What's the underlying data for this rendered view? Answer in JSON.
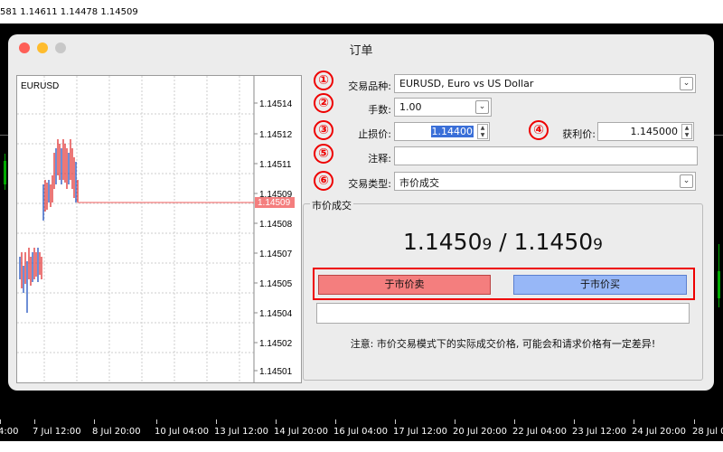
{
  "top_ticker": "581 1.14611 1.14478 1.14509",
  "window": {
    "title": "订单"
  },
  "chart": {
    "symbol": "EURUSD",
    "price_labels": [
      "1.14514",
      "1.14512",
      "1.14511",
      "1.14509",
      "1.14508",
      "1.14507",
      "1.14505",
      "1.14504",
      "1.14502",
      "1.14501"
    ],
    "current_price_tag": "1.14509",
    "colors": {
      "line": "#f47e7e",
      "tag_bg": "#f47e7e",
      "bull": "#e03030",
      "bear": "#2050c0"
    }
  },
  "form": {
    "circle_numbers": [
      "①",
      "②",
      "③",
      "④",
      "⑤",
      "⑥"
    ],
    "symbol_label": "交易品种:",
    "symbol_value": "EURUSD, Euro vs US Dollar",
    "lots_label": "手数:",
    "lots_value": "1.00",
    "sl_label": "止损价:",
    "sl_value": "1.14400",
    "tp_label": "获利价:",
    "tp_value": "1.145000",
    "comment_label": "注释:",
    "comment_value": "",
    "type_label": "交易类型:",
    "type_value": "市价成交"
  },
  "market": {
    "group_title": "市价成交",
    "bid_main": "1.1450",
    "bid_small": "9",
    "separator": " / ",
    "ask_main": "1.1450",
    "ask_small": "9",
    "sell_label": "于市价卖",
    "buy_label": "于市价买",
    "note": "注意: 市价交易模式下的实际成交价格, 可能会和请求价格有一定差异!"
  },
  "bottom_axis": [
    "4:00",
    "7 Jul 12:00",
    "8 Jul 20:00",
    "10 Jul 04:00",
    "13 Jul 12:00",
    "14 Jul 20:00",
    "16 Jul 04:00",
    "17 Jul 12:00",
    "20 Jul 20:00",
    "22 Jul 04:00",
    "23 Jul 12:00",
    "24 Jul 20:00",
    "28 Jul 0"
  ]
}
